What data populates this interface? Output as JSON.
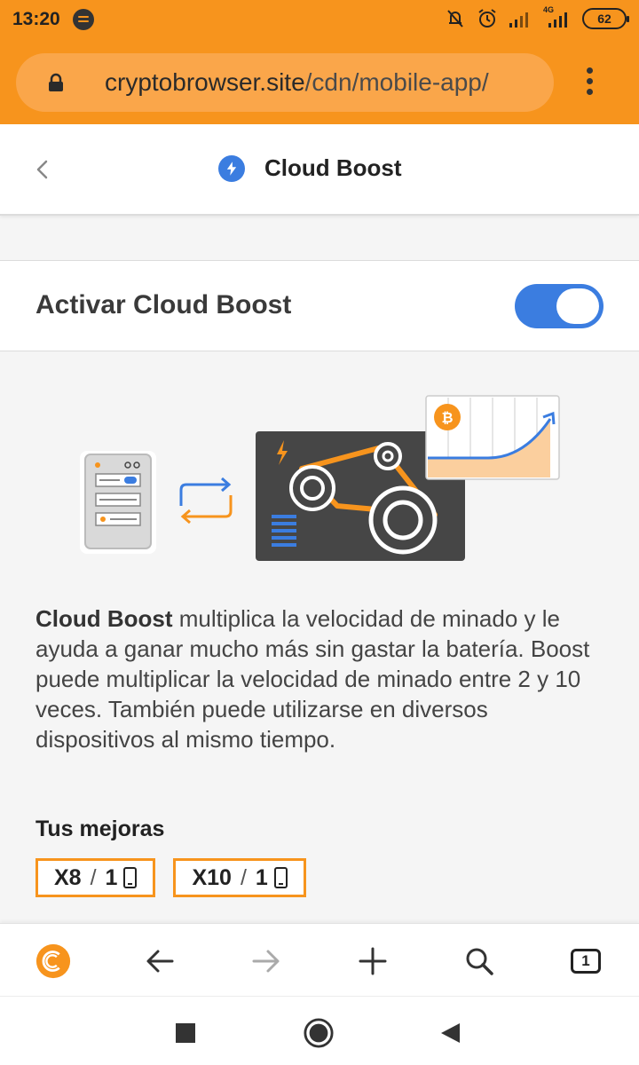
{
  "status_bar": {
    "time": "13:20",
    "network": "4G",
    "battery": "62"
  },
  "browser": {
    "url_domain": "cryptobrowser.site",
    "url_path": "/cdn/mobile-app/"
  },
  "header": {
    "title": "Cloud Boost",
    "icon": "bolt-icon"
  },
  "toggle": {
    "label": "Activar Cloud Boost",
    "state": "on"
  },
  "description": {
    "bold": "Cloud Boost",
    "text": " multiplica la velocidad de minado y le ayuda a ganar mucho más sin gastar la batería. Boost puede multiplicar la velocidad de minado entre 2 y 10 veces. También puede utilizarse en diversos dispositivos al mismo tiempo."
  },
  "mejoras": {
    "title": "Tus mejoras",
    "items": [
      {
        "multiplier": "X8",
        "slash": "/",
        "count": "1"
      },
      {
        "multiplier": "X10",
        "slash": "/",
        "count": "1"
      }
    ]
  },
  "toolbar": {
    "tab_count": "1"
  },
  "colors": {
    "brand_orange": "#f7941d",
    "accent_blue": "#3b7de0"
  }
}
